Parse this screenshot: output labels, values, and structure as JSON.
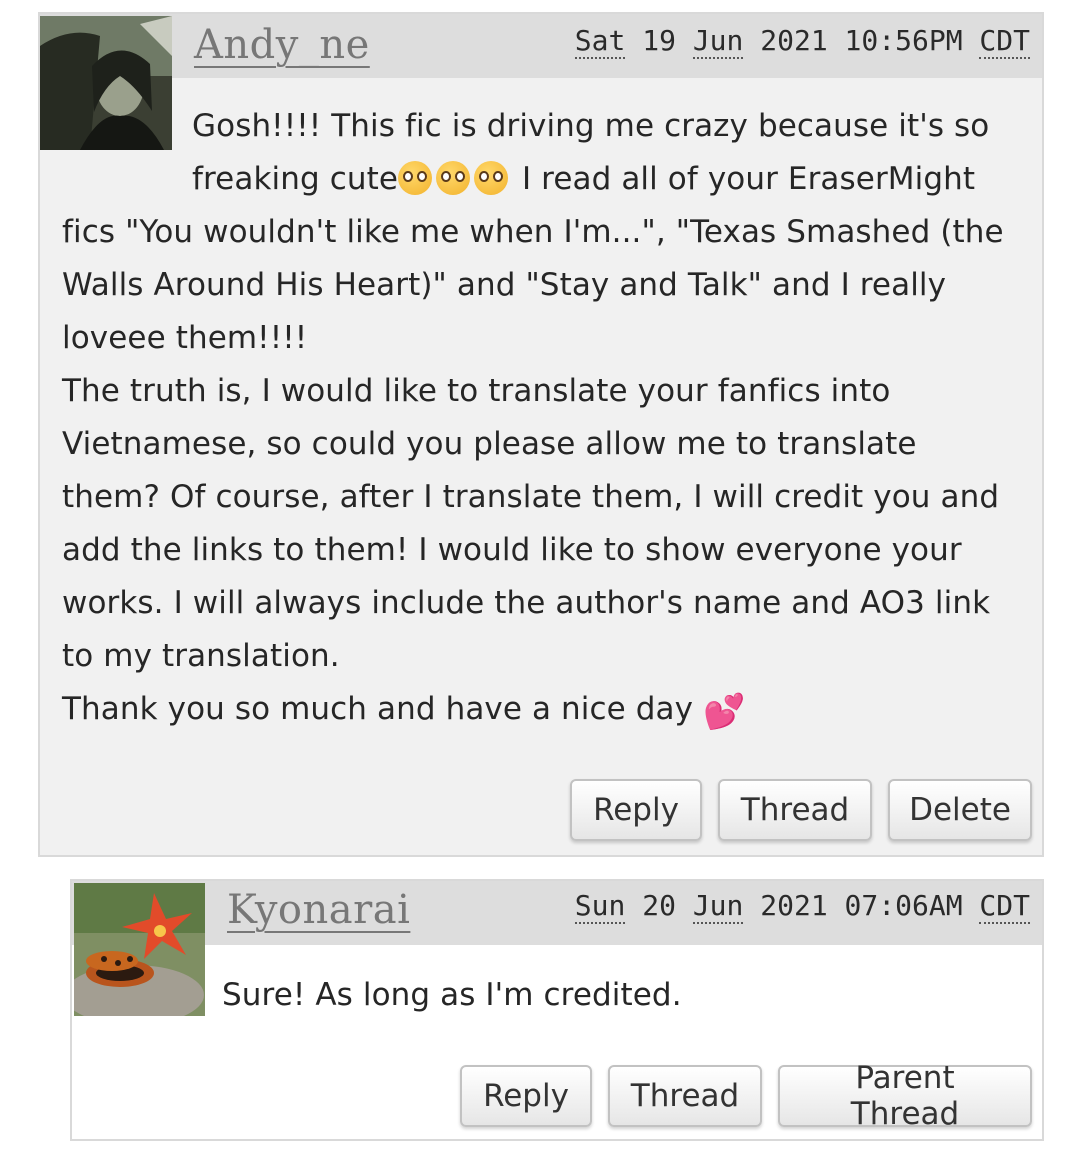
{
  "comments": [
    {
      "author": "Andy_ne",
      "date": {
        "day": "Sat",
        "date": "19",
        "month": "Jun",
        "year": "2021",
        "time": "10:56PM",
        "tz": "CDT"
      },
      "body": {
        "line1": "Gosh!!!! This fic is driving me crazy because it's so freaking cute",
        "emoji": [
          "pleading-face-emoji",
          "pleading-face-emoji",
          "pleading-face-emoji"
        ],
        "line1b": " I read all of your EraserMight fics \"You wouldn't like me when I'm...\", \"Texas Smashed (the Walls Around His Heart)\" and \"Stay and Talk\" and I really loveee them!!!!",
        "p2": "The truth is, I would like to translate your fanfics into Vietnamese, so could you please allow me to translate them? Of course, after I translate them, I will credit you and add the links to them! I would like to show everyone your works. I will always include the author's name and AO3 link to my translation.",
        "p3": "Thank you so much and have a nice day ",
        "p3_emoji": "two-hearts-emoji"
      },
      "actions": {
        "reply": "Reply",
        "thread": "Thread",
        "delete": "Delete"
      }
    },
    {
      "author": "Kyonarai",
      "date": {
        "day": "Sun",
        "date": "20",
        "month": "Jun",
        "year": "2021",
        "time": "07:06AM",
        "tz": "CDT"
      },
      "body": {
        "text": "Sure! As long as I'm credited."
      },
      "actions": {
        "reply": "Reply",
        "thread": "Thread",
        "parent_thread": "Parent Thread"
      }
    }
  ],
  "colors": {
    "heading_bg": "#dddddd",
    "comment1_bg": "#f1f1f1",
    "heart": "#ff4fa3"
  }
}
